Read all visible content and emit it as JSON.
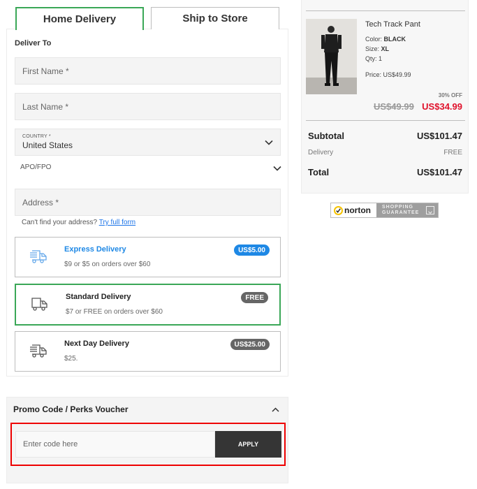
{
  "tabs": [
    {
      "label": "Home Delivery",
      "active": true
    },
    {
      "label": "Ship to Store",
      "active": false
    }
  ],
  "delivery": {
    "heading": "Deliver To",
    "first_name_placeholder": "First Name *",
    "last_name_placeholder": "Last Name *",
    "country_label": "COUNTRY *",
    "country_value": "United States",
    "apo_label": "APO/FPO",
    "address_placeholder": "Address *",
    "cant_find_text": "Can't find your address?",
    "full_form_link": "Try full form",
    "options": [
      {
        "title": "Express Delivery",
        "desc": "$9 or $5 on orders over $60",
        "badge": "US$5.00",
        "selected": false,
        "icon": "fast-truck-icon"
      },
      {
        "title": "Standard Delivery",
        "desc": "$7 or FREE on orders over $60",
        "badge": "FREE",
        "selected": true,
        "icon": "truck-icon"
      },
      {
        "title": "Next Day Delivery",
        "desc": "$25.",
        "badge": "US$25.00",
        "selected": false,
        "icon": "fast-truck-icon"
      }
    ]
  },
  "promo": {
    "title": "Promo Code / Perks Voucher",
    "placeholder": "Enter code here",
    "apply_label": "APPLY"
  },
  "summary": {
    "product": {
      "name": "Tech Track Pant",
      "color_label": "Color:",
      "color": "BLACK",
      "size_label": "Size:",
      "size": "XL",
      "qty_label": "Qty:",
      "qty": "1",
      "price_label": "Price:",
      "price": "US$49.99",
      "discount": "30% OFF",
      "old_price": "US$49.99",
      "new_price": "US$34.99"
    },
    "subtotal_label": "Subtotal",
    "subtotal": "US$101.47",
    "delivery_label": "Delivery",
    "delivery": "FREE",
    "total_label": "Total",
    "total": "US$101.47"
  },
  "norton": {
    "brand": "norton",
    "line1": "SHOPPING",
    "line2": "GUARANTEE"
  },
  "colors": {
    "accent_green": "#3aa757",
    "express_blue": "#1e88e5",
    "sale_red": "#e0112b",
    "highlight_red": "#ee0000"
  }
}
